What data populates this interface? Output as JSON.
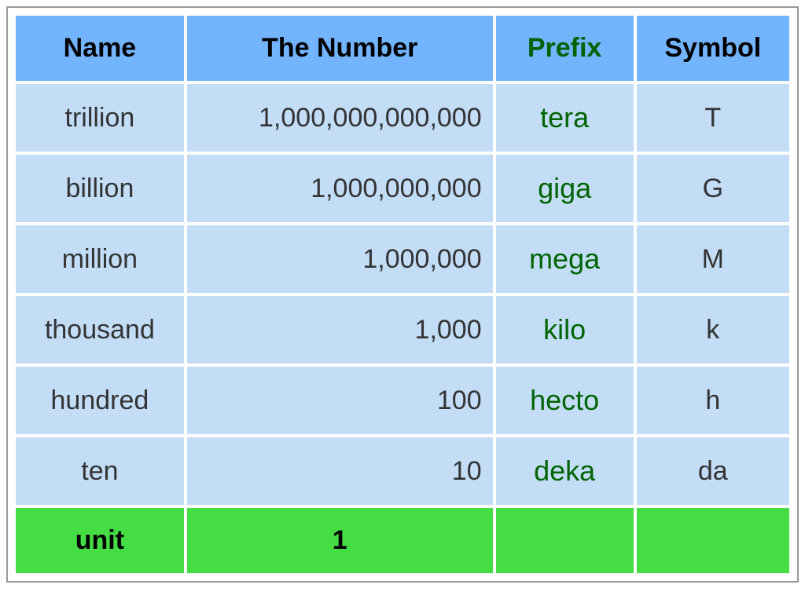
{
  "chart_data": {
    "type": "table",
    "title": "",
    "headers": [
      "Name",
      "The Number",
      "Prefix",
      "Symbol"
    ],
    "rows": [
      {
        "name": "trillion",
        "number": "1,000,000,000,000",
        "prefix": "tera",
        "symbol": "T",
        "highlight": false
      },
      {
        "name": "billion",
        "number": "1,000,000,000",
        "prefix": "giga",
        "symbol": "G",
        "highlight": false
      },
      {
        "name": "million",
        "number": "1,000,000",
        "prefix": "mega",
        "symbol": "M",
        "highlight": false
      },
      {
        "name": "thousand",
        "number": "1,000",
        "prefix": "kilo",
        "symbol": "k",
        "highlight": false
      },
      {
        "name": "hundred",
        "number": "100",
        "prefix": "hecto",
        "symbol": "h",
        "highlight": false
      },
      {
        "name": "ten",
        "number": "10",
        "prefix": "deka",
        "symbol": "da",
        "highlight": false
      },
      {
        "name": "unit",
        "number": "1",
        "prefix": "",
        "symbol": "",
        "highlight": true
      }
    ]
  },
  "colors": {
    "header_bg": "#73b4ff",
    "cell_bg": "#c3ddf7",
    "highlight_bg": "#44dd44",
    "prefix_text": "#006400"
  }
}
